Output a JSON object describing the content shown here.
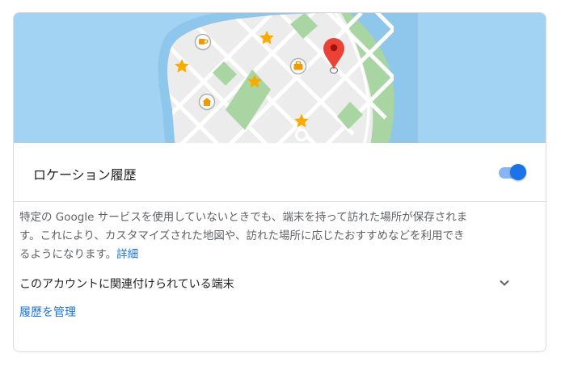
{
  "location_history": {
    "title": "ロケーション履歴",
    "toggle_state": "on"
  },
  "description": {
    "text": "特定の Google サービスを使用していないときでも、端末を持って訪れた場所が保存されます。これにより、カスタマイズされた地図や、訪れた場所に応じたおすすめなどを利用できるようになります。",
    "link": "詳細"
  },
  "devices": {
    "label": "このアカウントに関連付けられている端末",
    "icon": "chevron-down-icon"
  },
  "manage_link": "履歴を管理",
  "map_icons": [
    "cafe-icon",
    "star-icon",
    "briefcase-icon",
    "home-icon",
    "location-pin-icon"
  ],
  "colors": {
    "accent": "#1a73e8",
    "water": "#a3d3f2",
    "park": "#a8d5a2",
    "pin": "#ea4335",
    "star": "#f9ab00"
  }
}
